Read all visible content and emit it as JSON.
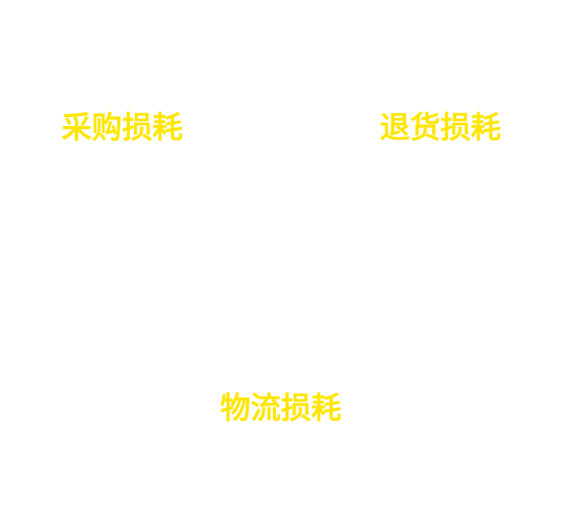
{
  "labels": {
    "purchase_loss": "采购损耗",
    "return_loss": "退货损耗",
    "logistics_loss": "物流损耗"
  },
  "colors": {
    "background": "#ffffff",
    "label_text": "#ffe600"
  }
}
